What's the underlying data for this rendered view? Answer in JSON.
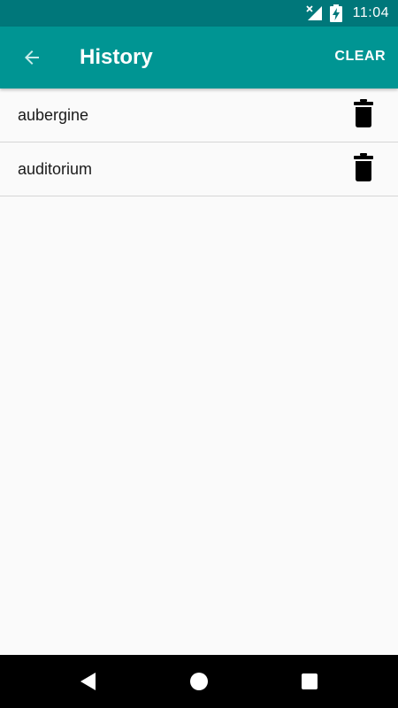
{
  "status_bar": {
    "time": "11:04",
    "icons": [
      "signal-no-data-icon",
      "battery-charging-icon"
    ],
    "background": "#00777a"
  },
  "app_bar": {
    "title": "History",
    "back_icon": "arrow-back-icon",
    "clear_label": "CLEAR",
    "background": "#009593"
  },
  "history": {
    "items": [
      {
        "label": "aubergine",
        "action_icon": "trash-icon"
      },
      {
        "label": "auditorium",
        "action_icon": "trash-icon"
      }
    ]
  },
  "nav_bar": {
    "buttons": [
      "nav-back-icon",
      "nav-home-icon",
      "nav-recents-icon"
    ]
  }
}
